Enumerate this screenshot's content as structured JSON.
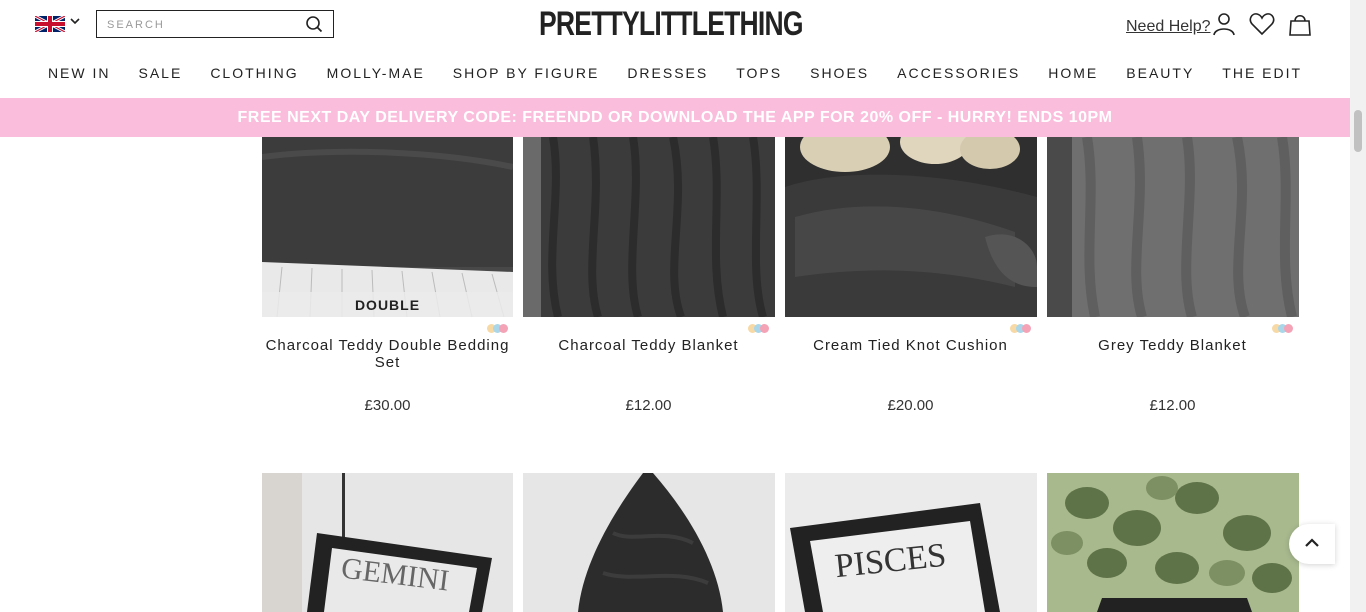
{
  "header": {
    "country": "UK",
    "search_placeholder": "SEARCH",
    "logo": "PRETTYLITTLETHING",
    "help": "Need Help?"
  },
  "nav": [
    "NEW IN",
    "SALE",
    "CLOTHING",
    "MOLLY-MAE",
    "SHOP BY FIGURE",
    "DRESSES",
    "TOPS",
    "SHOES",
    "ACCESSORIES",
    "HOME",
    "BEAUTY",
    "THE EDIT"
  ],
  "promo": "FREE NEXT DAY DELIVERY CODE: FREENDD OR DOWNLOAD THE APP FOR 20% OFF - HURRY! ENDS 10PM",
  "products": [
    {
      "name": "Charcoal Teddy Double Bedding Set",
      "price": "£30.00",
      "tag": "DOUBLE"
    },
    {
      "name": "Charcoal Teddy Blanket",
      "price": "£12.00"
    },
    {
      "name": "Cream Tied Knot Cushion",
      "price": "£20.00"
    },
    {
      "name": "Grey Teddy Blanket",
      "price": "£12.00"
    }
  ],
  "second_row": [
    {
      "image_text": "GEMINI"
    },
    {
      "image_text": ""
    },
    {
      "image_text": "PISCES"
    },
    {
      "image_text": ""
    }
  ],
  "colors": {
    "promo_bg": "#fbbddc",
    "accent": "#222222"
  }
}
